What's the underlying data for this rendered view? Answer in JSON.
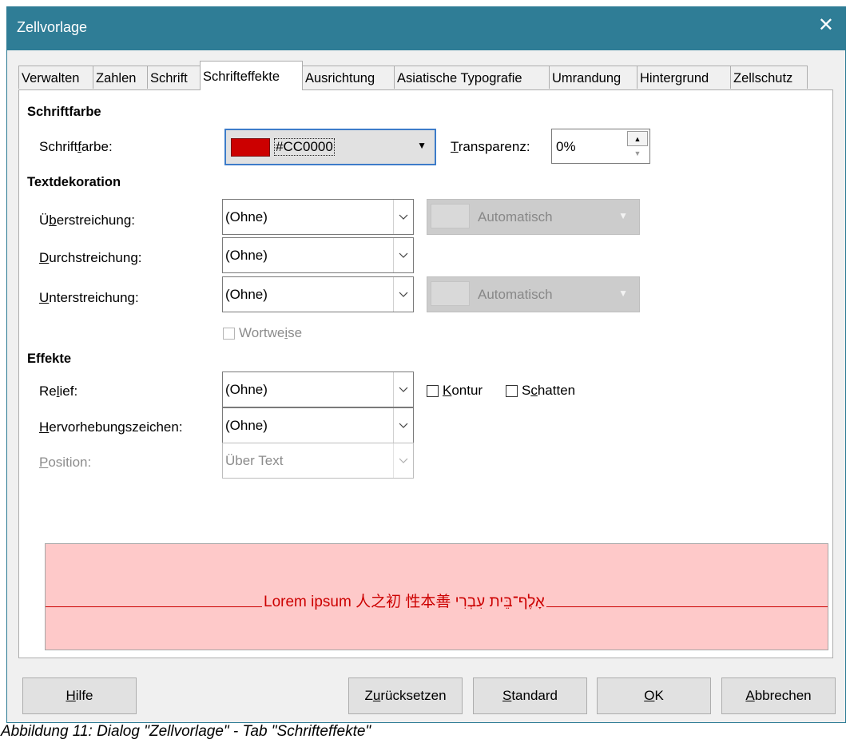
{
  "window": {
    "title": "Zellvorlage",
    "close_glyph": "✕"
  },
  "tabs": [
    {
      "label": "Verwalten"
    },
    {
      "label": "Zahlen"
    },
    {
      "label": "Schrift"
    },
    {
      "label": "Schrifteffekte"
    },
    {
      "label": "Ausrichtung"
    },
    {
      "label": "Asiatische Typografie"
    },
    {
      "label": "Umrandung"
    },
    {
      "label": "Hintergrund"
    },
    {
      "label": "Zellschutz"
    }
  ],
  "active_tab": "Schrifteffekte",
  "font_color_section": {
    "heading": "Schriftfarbe",
    "label": "Schriftfarbe:",
    "color_value": "#CC0000",
    "color_hex": "#CC0000",
    "transparency_label": "Transparenz:",
    "transparency_value": "0%"
  },
  "text_decoration": {
    "heading": "Textdekoration",
    "overline_label": "Überstreichung:",
    "overline_value": "(Ohne)",
    "overline_color": "Automatisch",
    "strikethrough_label": "Durchstreichung:",
    "strikethrough_value": "(Ohne)",
    "underline_label": "Unterstreichung:",
    "underline_value": "(Ohne)",
    "underline_color": "Automatisch",
    "wordwise_label": "Wortweise"
  },
  "effects": {
    "heading": "Effekte",
    "relief_label": "Relief:",
    "relief_value": "(Ohne)",
    "outline_label": "Kontur",
    "shadow_label": "Schatten",
    "emphasis_label": "Hervorhebungszeichen:",
    "emphasis_value": "(Ohne)",
    "position_label": "Position:",
    "position_value": "Über Text"
  },
  "preview": {
    "text": "Lorem ipsum   人之初 性本善   אָלֶף־בֵּית עִבְרִי",
    "background": "#FEC9C9",
    "line_color": "#CC0000"
  },
  "buttons": {
    "help": "Hilfe",
    "reset": "Zurücksetzen",
    "standard": "Standard",
    "ok": "OK",
    "cancel": "Abbrechen"
  },
  "caption": "Abbildung 11: Dialog \"Zellvorlage\" - Tab \"Schrifteffekte\""
}
